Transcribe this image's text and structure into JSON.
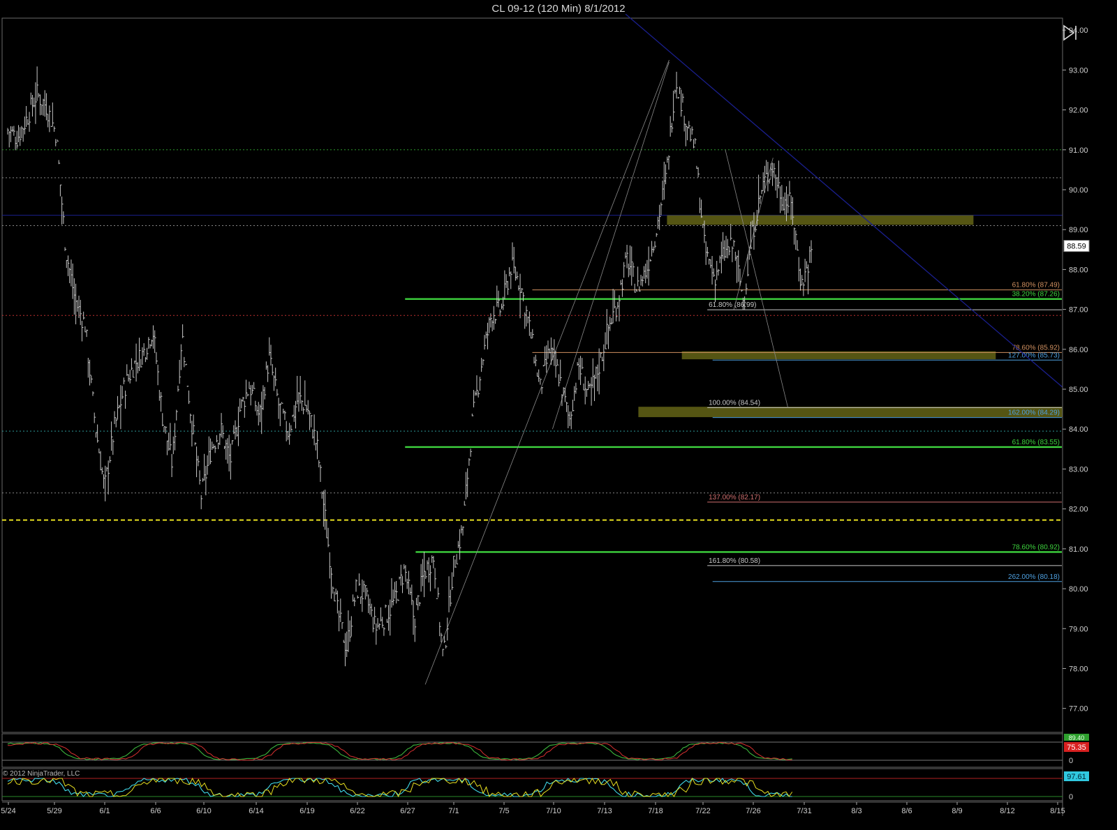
{
  "window": {
    "title": "CL 09-12 (120 Min)  8/1/2012"
  },
  "copyright": "© 2012 NinjaTrader, LLC",
  "toolbar": {
    "play_icon": "play-pause-icon"
  },
  "colors": {
    "background": "#000000",
    "bars": "#c8c8c8",
    "fib_green": "#3ed43e",
    "zone": "#5a5a14",
    "trend": "#1a1f6e",
    "support_yellow": "#e8e020",
    "last_price_badge": "#ffffff",
    "ind1_fast": "#d83030",
    "ind1_slow": "#3cb43c",
    "ind2_fast": "#e8e020",
    "ind2_slow": "#40d8e8"
  },
  "chart_data": {
    "type": "bar",
    "instrument": "CL 09-12",
    "interval": "120 Min",
    "ylim": [
      76.4,
      94.3
    ],
    "y_ticks": [
      "94.00",
      "93.00",
      "92.00",
      "91.00",
      "90.00",
      "89.00",
      "88.00",
      "87.00",
      "86.00",
      "85.00",
      "84.00",
      "83.00",
      "82.00",
      "81.00",
      "80.00",
      "79.00",
      "78.00",
      "77.00"
    ],
    "x_ticks": [
      "5/24",
      "5/29",
      "6/1",
      "6/6",
      "6/10",
      "6/14",
      "6/19",
      "6/22",
      "6/27",
      "7/1",
      "7/5",
      "7/10",
      "7/13",
      "7/18",
      "7/22",
      "7/26",
      "7/31",
      "8/3",
      "8/6",
      "8/9",
      "8/12",
      "8/15"
    ],
    "last_price": "88.59",
    "close_path": [
      [
        0,
        91.5
      ],
      [
        1,
        91.3
      ],
      [
        2,
        91.8
      ],
      [
        3,
        92.4
      ],
      [
        4,
        92.1
      ],
      [
        5,
        91.4
      ],
      [
        6,
        88.5
      ],
      [
        7,
        87.2
      ],
      [
        8,
        86.6
      ],
      [
        9,
        84.2
      ],
      [
        10,
        82.5
      ],
      [
        11,
        84.0
      ],
      [
        12,
        85.0
      ],
      [
        13,
        85.6
      ],
      [
        14,
        85.9
      ],
      [
        15,
        86.5
      ],
      [
        16,
        84.3
      ],
      [
        17,
        83.1
      ],
      [
        18,
        86.4
      ],
      [
        19,
        84.2
      ],
      [
        20,
        82.3
      ],
      [
        21,
        83.5
      ],
      [
        22,
        84.0
      ],
      [
        23,
        83.2
      ],
      [
        24,
        84.5
      ],
      [
        25,
        85.1
      ],
      [
        26,
        84.3
      ],
      [
        27,
        85.8
      ],
      [
        28,
        84.6
      ],
      [
        29,
        83.9
      ],
      [
        30,
        84.8
      ],
      [
        31,
        84.5
      ],
      [
        32,
        83.5
      ],
      [
        33,
        81.3
      ],
      [
        34,
        79.5
      ],
      [
        35,
        78.5
      ],
      [
        36,
        80.0
      ],
      [
        37,
        79.8
      ],
      [
        38,
        79.0
      ],
      [
        39,
        79.3
      ],
      [
        40,
        79.7
      ],
      [
        41,
        80.5
      ],
      [
        42,
        79.2
      ],
      [
        43,
        80.4
      ],
      [
        44,
        80.8
      ],
      [
        45,
        78.2
      ],
      [
        46,
        80.5
      ],
      [
        47,
        81.5
      ],
      [
        48,
        84.2
      ],
      [
        49,
        85.7
      ],
      [
        50,
        86.9
      ],
      [
        51,
        87.0
      ],
      [
        52,
        88.1
      ],
      [
        53,
        87.6
      ],
      [
        54,
        86.4
      ],
      [
        55,
        85.0
      ],
      [
        56,
        86.0
      ],
      [
        57,
        85.3
      ],
      [
        58,
        84.2
      ],
      [
        59,
        85.6
      ],
      [
        60,
        84.8
      ],
      [
        61,
        85.5
      ],
      [
        62,
        86.5
      ],
      [
        63,
        87.2
      ],
      [
        64,
        88.3
      ],
      [
        65,
        87.5
      ],
      [
        66,
        88.0
      ],
      [
        67,
        89.0
      ],
      [
        68,
        90.3
      ],
      [
        69,
        92.8
      ],
      [
        70,
        91.8
      ],
      [
        71,
        91.0
      ],
      [
        72,
        88.5
      ],
      [
        73,
        87.8
      ],
      [
        74,
        88.4
      ],
      [
        75,
        88.6
      ],
      [
        76,
        87.2
      ],
      [
        77,
        89.0
      ],
      [
        78,
        90.1
      ],
      [
        79,
        90.6
      ],
      [
        80,
        89.8
      ],
      [
        81,
        89.6
      ],
      [
        82,
        87.6
      ],
      [
        83,
        88.4
      ]
    ],
    "lows": [
      90.2,
      91.0,
      90.3,
      88.0,
      86.0,
      81.9,
      85.0,
      82.8,
      81.7,
      83.5,
      82.6,
      81.6,
      77.9,
      77.6,
      84.5,
      84.3,
      87.3
    ],
    "highs": [
      92.9,
      89.2,
      87.8,
      87.3,
      86.2,
      85.1,
      85.3,
      81.2,
      89.2,
      86.8,
      93.3,
      91.0,
      90.3
    ],
    "horizontal_lines": [
      {
        "price": 91.0,
        "style": "dotted",
        "color": "#2e9a2e"
      },
      {
        "price": 90.3,
        "style": "dotted",
        "color": "#888888"
      },
      {
        "price": 89.36,
        "style": "solid",
        "color": "#1a1f8e"
      },
      {
        "price": 89.1,
        "style": "dotted",
        "color": "#888888"
      },
      {
        "price": 86.85,
        "style": "dotted",
        "color": "#c03030"
      },
      {
        "price": 83.95,
        "style": "dotted",
        "color": "#2e9a9a"
      },
      {
        "price": 82.4,
        "style": "dotted",
        "color": "#888888"
      },
      {
        "price": 81.72,
        "style": "dashed",
        "color": "#e8e020"
      }
    ],
    "fib_lines": [
      {
        "label": "61.80% (87.49)",
        "price": 87.49,
        "color": "#d09060",
        "align": "right",
        "x_start": 0.5
      },
      {
        "label": "38.20% (87.26)",
        "price": 87.26,
        "color": "#3ed43e",
        "align": "right",
        "x_start": 0.38,
        "thick": true
      },
      {
        "label": "61.80% (86.99)",
        "price": 86.99,
        "color": "#c8c8c8",
        "align": "left",
        "x_start": 0.665
      },
      {
        "label": "78.60% (85.92)",
        "price": 85.92,
        "color": "#d09060",
        "align": "right",
        "x_start": 0.5
      },
      {
        "label": "127.00% (85.73)",
        "price": 85.73,
        "color": "#4ea0e0",
        "align": "right",
        "x_start": 0.67
      },
      {
        "label": "100.00% (84.54)",
        "price": 84.54,
        "color": "#c8c8c8",
        "align": "left",
        "x_start": 0.665
      },
      {
        "label": "162.00% (84.29)",
        "price": 84.29,
        "color": "#4ea0e0",
        "align": "right",
        "x_start": 0.67
      },
      {
        "label": "61.80% (83.55)",
        "price": 83.55,
        "color": "#3ed43e",
        "align": "right",
        "x_start": 0.38,
        "thick": true
      },
      {
        "label": "137.00% (82.17)",
        "price": 82.17,
        "color": "#d07070",
        "align": "left",
        "x_start": 0.665
      },
      {
        "label": "78.60% (80.92)",
        "price": 80.92,
        "color": "#3ed43e",
        "align": "right",
        "x_start": 0.39,
        "thick": true
      },
      {
        "label": "161.80% (80.58)",
        "price": 80.58,
        "color": "#c8c8c8",
        "align": "left",
        "x_start": 0.665
      },
      {
        "label": "262.00% (80.18)",
        "price": 80.18,
        "color": "#4ea0e0",
        "align": "right",
        "x_start": 0.67
      }
    ],
    "zones": [
      {
        "x0": 0.627,
        "x1": 0.916,
        "p0": 89.36,
        "p1": 89.12
      },
      {
        "x0": 0.641,
        "x1": 0.937,
        "p0": 85.95,
        "p1": 85.75
      },
      {
        "x0": 0.6,
        "x1": 1.0,
        "p0": 84.56,
        "p1": 84.3
      }
    ],
    "trendlines": [
      {
        "from": [
          0.588,
          94.4
        ],
        "to": [
          1.0,
          85.05
        ],
        "color": "#1a1f8e",
        "width": 1.3
      },
      {
        "from": [
          0.399,
          77.6
        ],
        "to": [
          0.629,
          93.25
        ],
        "color": "#8a8a8a",
        "width": 0.8
      },
      {
        "from": [
          0.519,
          84.0
        ],
        "to": [
          0.629,
          93.2
        ],
        "color": "#8a8a8a",
        "width": 0.8
      },
      {
        "from": [
          0.682,
          91.0
        ],
        "to": [
          0.741,
          84.54
        ],
        "color": "#8a8a8a",
        "width": 0.8
      },
      {
        "from": [
          0.69,
          87.0
        ],
        "to": [
          0.727,
          90.8
        ],
        "color": "#8a8a8a",
        "width": 0.8
      }
    ],
    "indicators": [
      {
        "name": "",
        "badge_top": "89.40",
        "badge": "75.35",
        "levels": [
          "0"
        ],
        "fast_color": "#d83030",
        "slow_color": "#3cb43c"
      },
      {
        "name": "",
        "badge": "97.61",
        "levels": [
          "0"
        ],
        "fast_color": "#e8e020",
        "slow_color": "#40d8e8"
      }
    ]
  }
}
